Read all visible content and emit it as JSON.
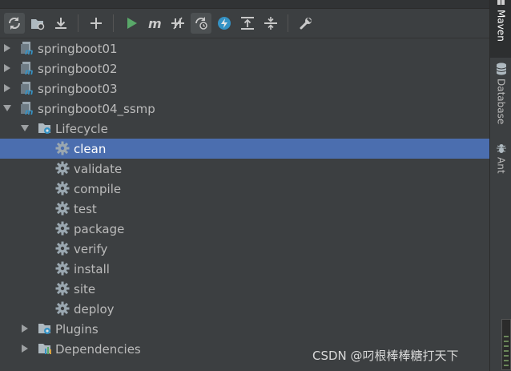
{
  "toolbar": {
    "buttons": [
      {
        "name": "reload-all-maven-projects-icon"
      },
      {
        "name": "generate-sources-icon"
      },
      {
        "name": "download-sources-icon"
      },
      {
        "name": "add-maven-project-icon"
      },
      {
        "name": "run-maven-build-icon"
      },
      {
        "name": "execute-maven-goal-icon"
      },
      {
        "name": "toggle-offline-mode-icon"
      },
      {
        "name": "toggle-skip-tests-icon"
      },
      {
        "name": "show-dependencies-icon"
      },
      {
        "name": "expand-all-icon"
      },
      {
        "name": "collapse-all-icon"
      },
      {
        "name": "maven-settings-icon"
      }
    ]
  },
  "tree": {
    "projects": [
      {
        "label": "springboot01",
        "expanded": false
      },
      {
        "label": "springboot02",
        "expanded": false
      },
      {
        "label": "springboot03",
        "expanded": false
      },
      {
        "label": "springboot04_ssmp",
        "expanded": true
      }
    ],
    "lifecycle_label": "Lifecycle",
    "goals": [
      "clean",
      "validate",
      "compile",
      "test",
      "package",
      "verify",
      "install",
      "site",
      "deploy"
    ],
    "selected_goal": "clean",
    "plugins_label": "Plugins",
    "dependencies_label": "Dependencies"
  },
  "sidebar": {
    "tabs": [
      {
        "label": "Maven",
        "active": true
      },
      {
        "label": "Database",
        "active": false
      },
      {
        "label": "Ant",
        "active": false
      }
    ]
  },
  "watermark": "CSDN @叼根棒棒糖打天下",
  "colors": {
    "background": "#3c3f41",
    "selection": "#4b6eaf",
    "run_green": "#59a869",
    "gear": "#9aa7b0",
    "maven_blue": "#3592c4"
  }
}
